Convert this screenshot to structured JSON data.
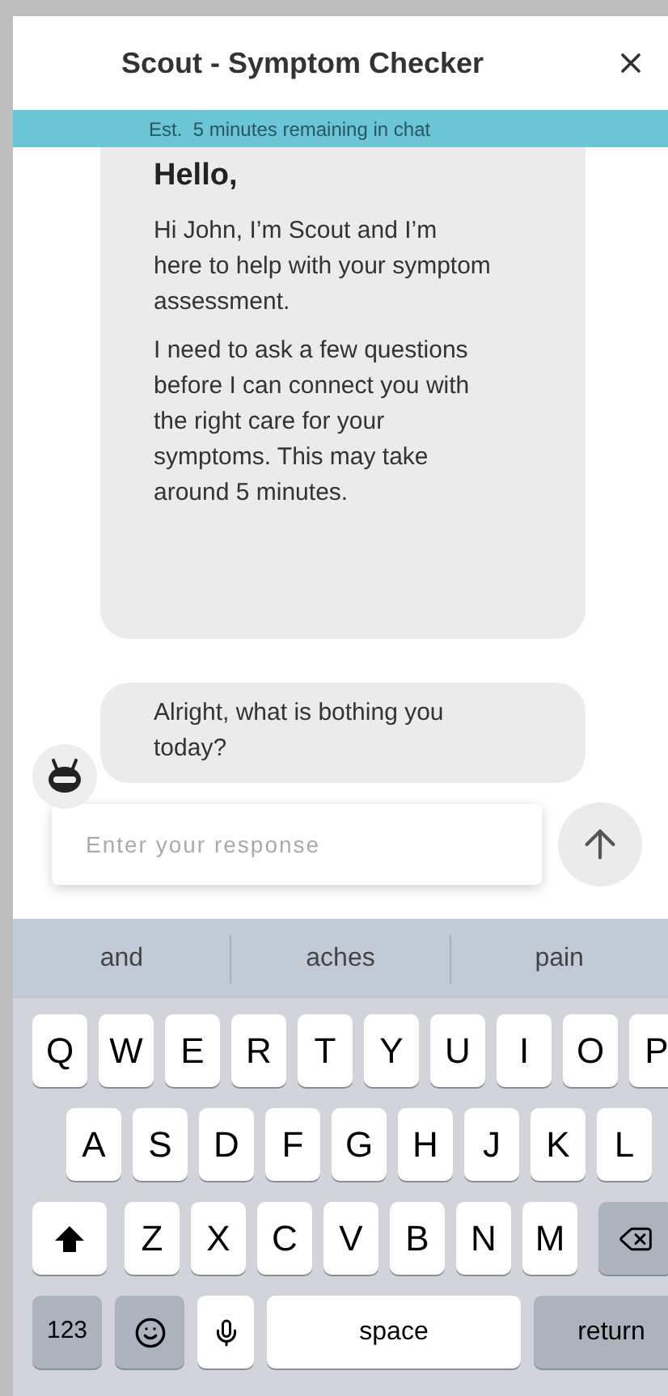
{
  "header": {
    "title": "Scout - Symptom Checker"
  },
  "banner": {
    "text": "Est.  5 minutes remaining in chat"
  },
  "messages": [
    {
      "parts": [
        {
          "kind": "heading",
          "text": "Hello,"
        },
        {
          "kind": "text",
          "text": "Hi John, I’m Scout and I’m here to help with your symptom assessment."
        },
        {
          "kind": "text",
          "text": "I need to ask a few questions before I can connect you with the right care for your symptoms. This may take around 5 minutes."
        }
      ]
    },
    {
      "parts": [
        {
          "kind": "text",
          "text": "Alright, what is bothing you today?"
        }
      ]
    }
  ],
  "composer": {
    "placeholder": "Enter your response"
  },
  "keyboard": {
    "suggestions": [
      "and",
      "aches",
      "pain"
    ],
    "rows": [
      {
        "keys": [
          {
            "kind": "letter",
            "label": "Q"
          },
          {
            "kind": "letter",
            "label": "W"
          },
          {
            "kind": "letter",
            "label": "E"
          },
          {
            "kind": "letter",
            "label": "R"
          },
          {
            "kind": "letter",
            "label": "T"
          },
          {
            "kind": "letter",
            "label": "Y"
          },
          {
            "kind": "letter",
            "label": "U"
          },
          {
            "kind": "letter",
            "label": "I"
          },
          {
            "kind": "letter",
            "label": "O"
          },
          {
            "kind": "letter",
            "label": "P"
          }
        ]
      },
      {
        "keys": [
          {
            "kind": "letter",
            "label": "A"
          },
          {
            "kind": "letter",
            "label": "S"
          },
          {
            "kind": "letter",
            "label": "D"
          },
          {
            "kind": "letter",
            "label": "F"
          },
          {
            "kind": "letter",
            "label": "G"
          },
          {
            "kind": "letter",
            "label": "H"
          },
          {
            "kind": "letter",
            "label": "J"
          },
          {
            "kind": "letter",
            "label": "K"
          },
          {
            "kind": "letter",
            "label": "L"
          }
        ]
      },
      {
        "keys": [
          {
            "kind": "shift"
          },
          {
            "kind": "letter",
            "label": "Z"
          },
          {
            "kind": "letter",
            "label": "X"
          },
          {
            "kind": "letter",
            "label": "C"
          },
          {
            "kind": "letter",
            "label": "V"
          },
          {
            "kind": "letter",
            "label": "B"
          },
          {
            "kind": "letter",
            "label": "N"
          },
          {
            "kind": "letter",
            "label": "M"
          },
          {
            "kind": "backspace"
          }
        ]
      },
      {
        "keys": [
          {
            "kind": "numbers",
            "label": "123"
          },
          {
            "kind": "emoji"
          },
          {
            "kind": "mic"
          },
          {
            "kind": "space",
            "label": "space"
          },
          {
            "kind": "return",
            "label": "return"
          }
        ]
      }
    ]
  }
}
